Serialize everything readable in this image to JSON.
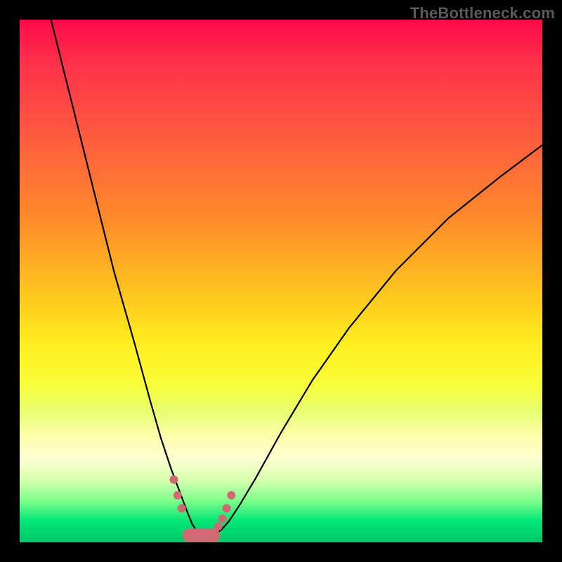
{
  "watermark": "TheBottleneck.com",
  "chart_data": {
    "type": "line",
    "title": "",
    "xlabel": "",
    "ylabel": "",
    "xlim": [
      0,
      100
    ],
    "ylim": [
      0,
      100
    ],
    "series": [
      {
        "name": "bottleneck-curve",
        "x": [
          6,
          10,
          14,
          18,
          22,
          25,
          27,
          29,
          30.5,
          32,
          33,
          34,
          35,
          36,
          37,
          38.5,
          40,
          42,
          45,
          50,
          56,
          63,
          72,
          82,
          92,
          100
        ],
        "y": [
          100,
          84,
          68,
          52,
          38,
          27,
          20,
          14,
          10,
          6,
          3.5,
          2,
          1.3,
          1.2,
          1.5,
          2.3,
          4,
          7,
          12,
          21,
          31,
          41,
          52,
          62,
          70,
          76
        ]
      }
    ],
    "markers": {
      "name": "highlight-dots",
      "x": [
        29.5,
        30.2,
        31,
        33.5,
        36,
        38,
        38.8,
        39.6,
        40.5
      ],
      "y": [
        12,
        9,
        6.5,
        1.6,
        1.6,
        3,
        4.5,
        6.5,
        9
      ],
      "color": "#d06a72",
      "size": 12
    },
    "trough_band": {
      "x_range": [
        32.5,
        37
      ],
      "y": 1.3,
      "color": "#d06a72",
      "thickness": 20
    }
  }
}
